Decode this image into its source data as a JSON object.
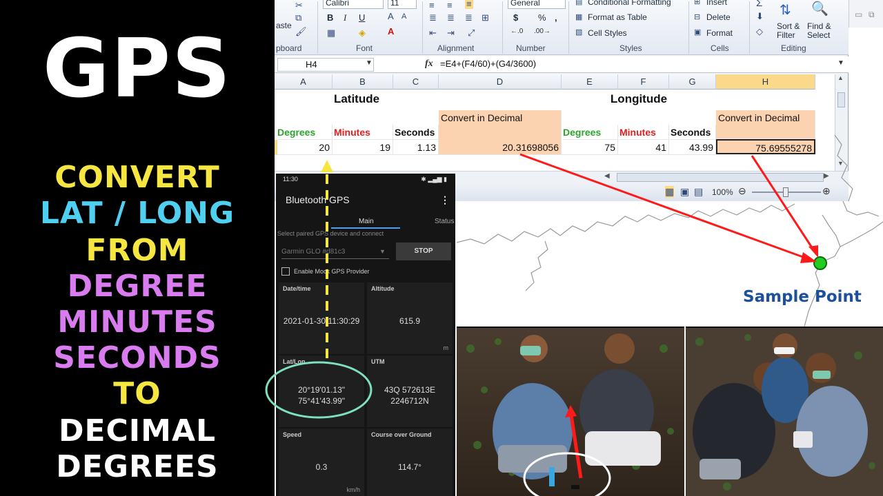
{
  "title": {
    "main": "GPS",
    "lines": [
      {
        "text": "CONVERT",
        "color": "#f5e642"
      },
      {
        "text": "LAT / LONG",
        "color": "#4fd0f0"
      },
      {
        "text": "FROM",
        "color": "#f5e642"
      },
      {
        "text": "DEGREE",
        "color": "#d87cf0"
      },
      {
        "text": "MINUTES",
        "color": "#d87cf0"
      },
      {
        "text": "SECONDS",
        "color": "#d87cf0"
      },
      {
        "text": "TO",
        "color": "#f5e642"
      },
      {
        "text": "DECIMAL",
        "color": "#ffffff"
      },
      {
        "text": "DEGREES",
        "color": "#ffffff"
      }
    ]
  },
  "excel": {
    "ribbon": {
      "font_name": "Calibri",
      "font_size": "11",
      "paste_label": "aste",
      "number_format": "General",
      "conditional_formatting": "Conditional Formatting",
      "format_as_table": "Format as Table",
      "cell_styles": "Cell Styles",
      "insert": "Insert",
      "delete": "Delete",
      "format": "Format",
      "sort_filter": "Sort & Filter",
      "find_select": "Find & Select",
      "groups": {
        "clipboard": "pboard",
        "font": "Font",
        "alignment": "Alignment",
        "number": "Number",
        "styles": "Styles",
        "cells": "Cells",
        "editing": "Editing"
      }
    },
    "name_box": "H4",
    "formula": "=E4+(F4/60)+(G4/3600)",
    "columns": [
      "A",
      "B",
      "C",
      "D",
      "E",
      "F",
      "G",
      "H"
    ],
    "selected_column": "H",
    "latitude_title": "Latitude",
    "longitude_title": "Longitude",
    "convert_label": "Convert in Decimal",
    "degrees_label": "Degrees",
    "minutes_label": "Minutes",
    "seconds_label": "Seconds",
    "row": {
      "lat_deg": "20",
      "lat_min": "19",
      "lat_sec": "1.13",
      "lat_dec": "20.31698056",
      "lon_deg": "75",
      "lon_min": "41",
      "lon_sec": "43.99",
      "lon_dec": "75.69555278"
    },
    "zoom": "100%"
  },
  "phone": {
    "status_time": "11:30",
    "app_title": "Bluetooth GPS",
    "tabs": [
      "Main",
      "Status"
    ],
    "paired_label": "Select paired GPS device and connect",
    "device": "Garmin GLO #d81c3",
    "stop_label": "STOP",
    "mock_label": "Enable Mock GPS Provider",
    "cards": {
      "datetime_title": "Date/time",
      "datetime_value": "2021-01-30 11:30:29",
      "altitude_title": "Altitude",
      "altitude_value": "615.9",
      "altitude_unit": "m",
      "latlon_title": "Lat/Lon",
      "lat_value": "20°19'01.13\"",
      "lon_value": "75°41'43.99\"",
      "utm_title": "UTM",
      "utm_line1": "43Q 572613E",
      "utm_line2": "2246712N",
      "speed_title": "Speed",
      "speed_value": "0.3",
      "speed_unit": "km/h",
      "course_title": "Course over Ground",
      "course_value": "114.7°"
    }
  },
  "map": {
    "sample_label": "Sample Point"
  }
}
